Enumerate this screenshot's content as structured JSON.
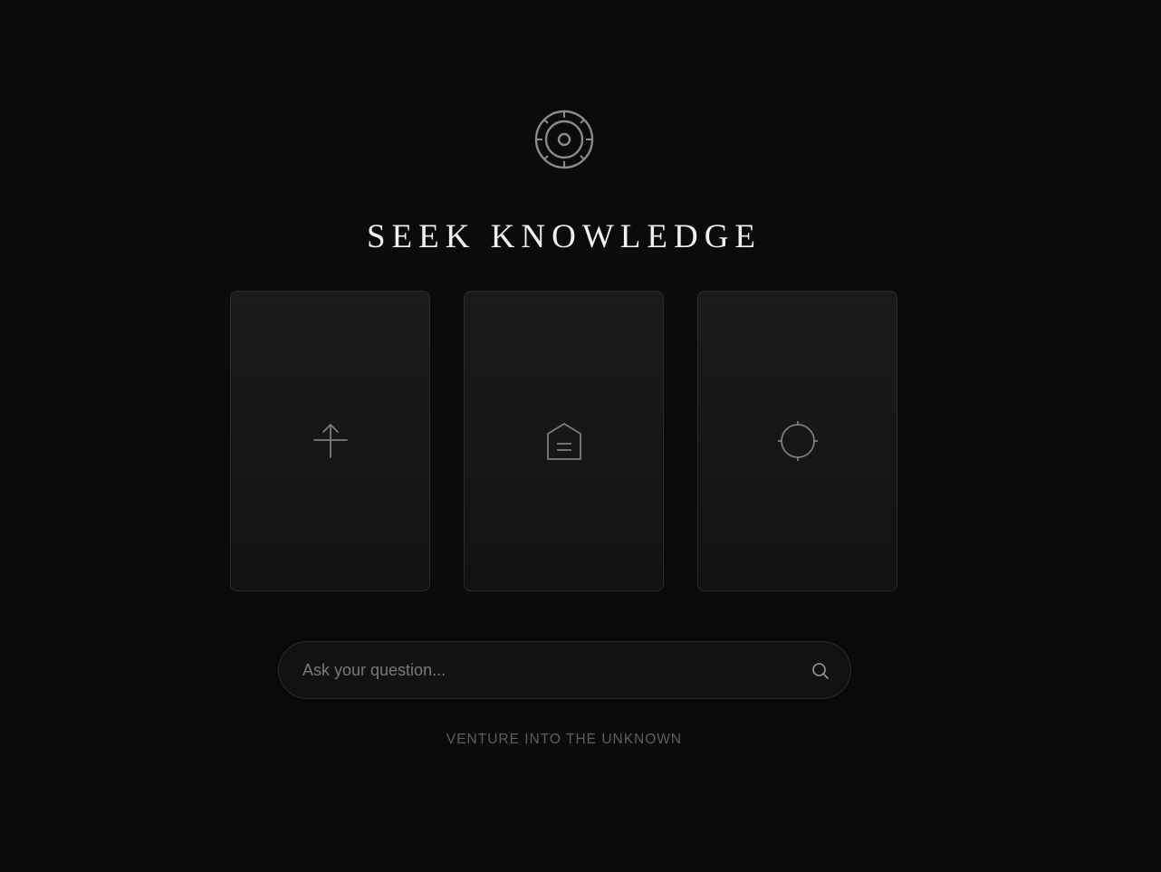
{
  "header": {
    "emblem_icon": "target-emblem-icon",
    "title": "SEEK KNOWLEDGE"
  },
  "cards": [
    {
      "icon": "arrow-up-cross-icon"
    },
    {
      "icon": "house-document-icon"
    },
    {
      "icon": "crosshair-icon"
    }
  ],
  "search": {
    "placeholder": "Ask your question...",
    "value": "",
    "icon": "search-icon"
  },
  "footer": {
    "tagline": "VENTURE INTO THE UNKNOWN"
  },
  "colors": {
    "background": "#0b0b0b",
    "card_border": "#2b2b2b",
    "icon_stroke": "#7d7d7d",
    "title": "#f0f0f0",
    "tagline": "#5e5e5e"
  }
}
